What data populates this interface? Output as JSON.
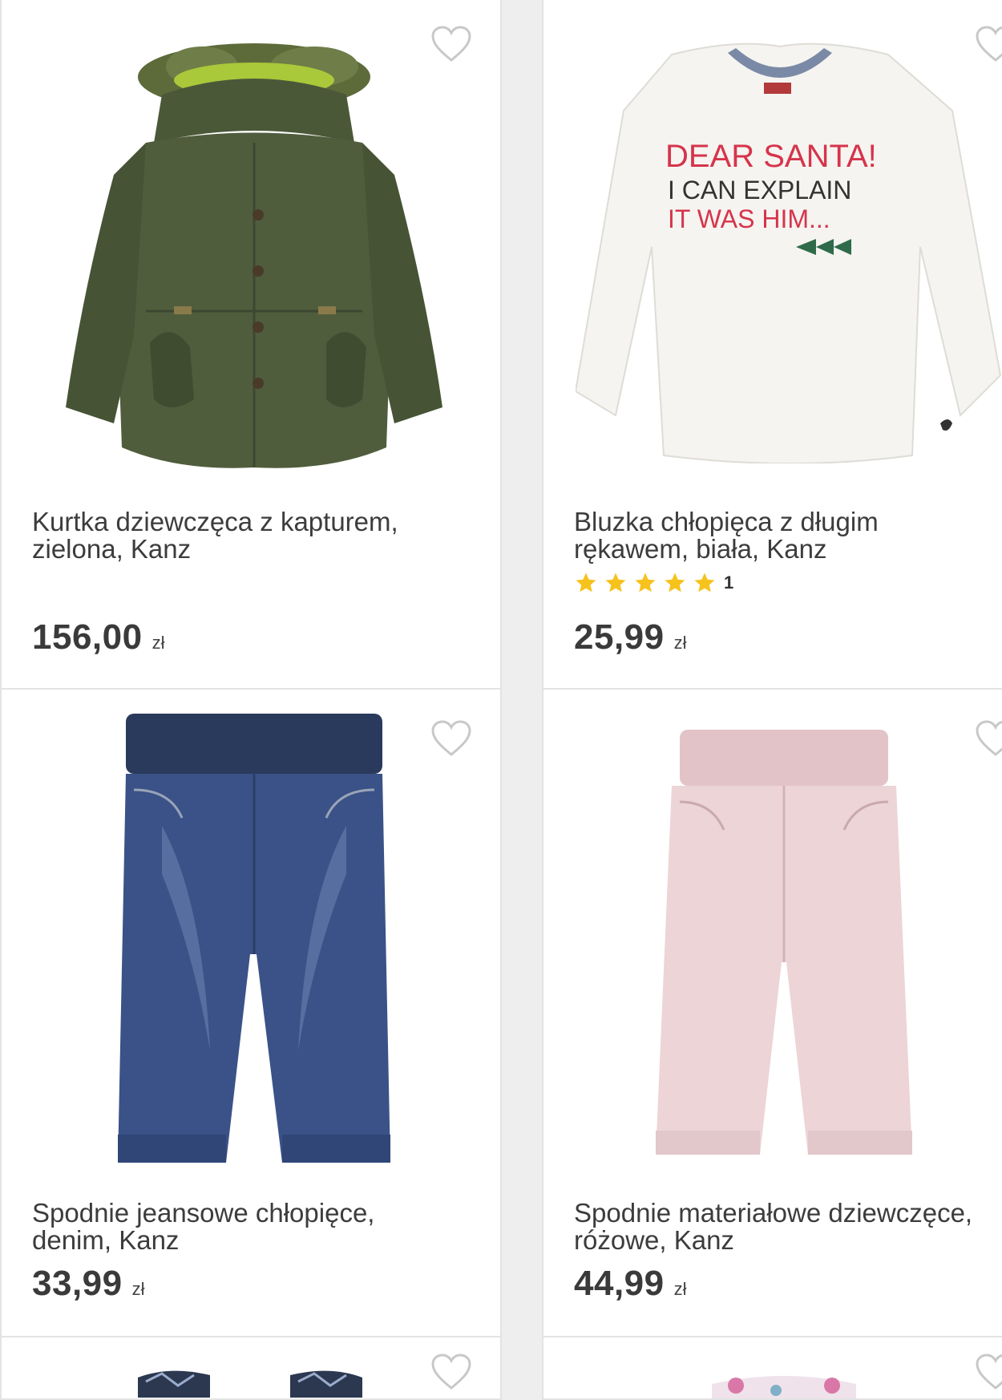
{
  "colors": {
    "background": "#eeeeee",
    "card": "#ffffff",
    "star": "#f6c21c",
    "heart": "#c8c8c8"
  },
  "products": [
    {
      "title_line1": "Kurtka dziewczęca z kapturem,",
      "title_line2": "zielona, Kanz",
      "price": "156,00",
      "currency": "zł",
      "favorite_icon": "heart-outline-icon"
    },
    {
      "title_line1": "Bluzka chłopięca z długim",
      "title_line2": "rękawem, biała, Kanz",
      "price": "25,99",
      "currency": "zł",
      "rating_stars": 5,
      "rating_count": "1",
      "favorite_icon": "heart-outline-icon",
      "print_text": {
        "line1": "DEAR SANTA!",
        "line2": "I CAN EXPLAIN",
        "line3": "IT WAS HIM..."
      }
    },
    {
      "title_line1": "Spodnie jeansowe chłopięce,",
      "title_line2": "denim, Kanz",
      "price": "33,99",
      "currency": "zł",
      "favorite_icon": "heart-outline-icon"
    },
    {
      "title_line1": "Spodnie materiałowe dziewczęce,",
      "title_line2": "różowe, Kanz",
      "price": "44,99",
      "currency": "zł",
      "favorite_icon": "heart-outline-icon"
    }
  ]
}
